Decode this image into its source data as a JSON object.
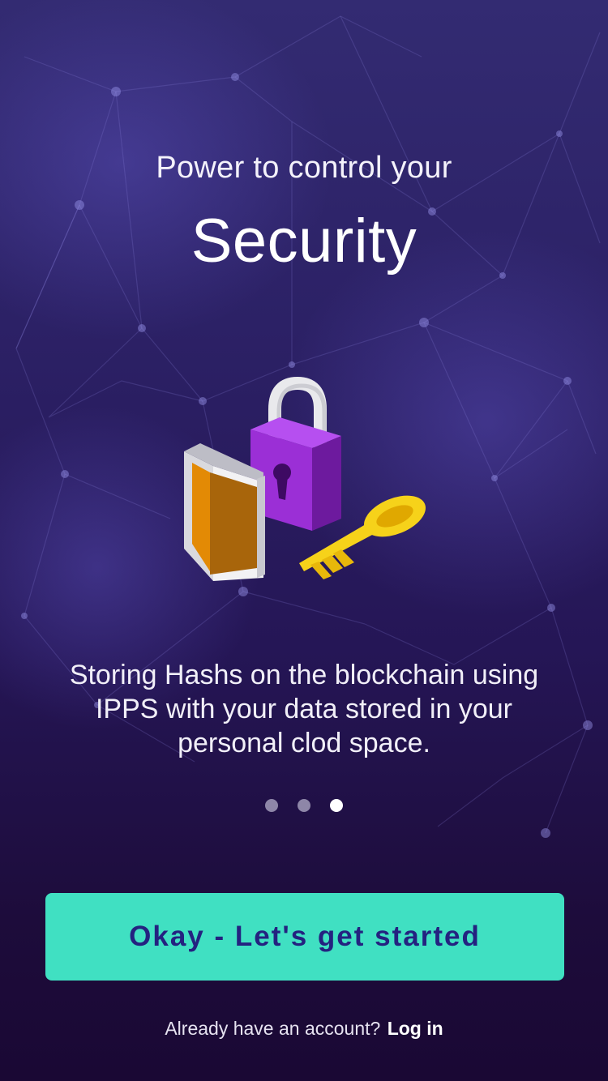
{
  "onboarding": {
    "subtitle": "Power to control your",
    "title": "Security",
    "description": "Storing Hashs on the blockchain using IPPS with your data stored in your personal clod space.",
    "pagination": {
      "total": 3,
      "active_index": 2
    },
    "cta_label": "Okay - Let's get started",
    "footer_prompt": "Already have an account?",
    "login_label": "Log in",
    "illustration_icons": [
      "shield-icon",
      "padlock-icon",
      "key-icon"
    ],
    "colors": {
      "accent": "#40e0c2",
      "button_text": "#242280",
      "background_top": "#332b72",
      "background_bottom": "#1a0834"
    }
  }
}
